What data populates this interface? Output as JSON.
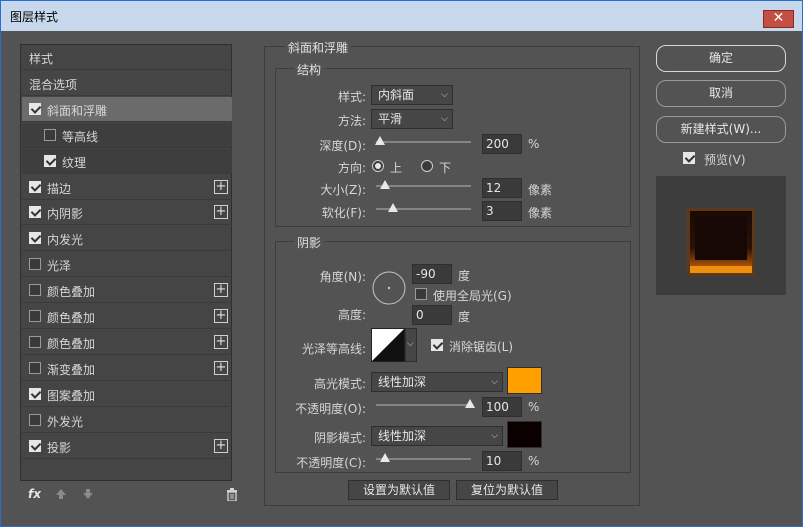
{
  "window": {
    "title": "图层样式",
    "close_glyph": "✕"
  },
  "left_panel": {
    "items": [
      {
        "label": "样式",
        "checkbox": null,
        "plus": false
      },
      {
        "label": "混合选项",
        "checkbox": null,
        "plus": false
      },
      {
        "label": "斜面和浮雕",
        "checkbox": true,
        "plus": false,
        "selected": true
      },
      {
        "label": "等高线",
        "checkbox": false,
        "plus": false,
        "sub": true
      },
      {
        "label": "纹理",
        "checkbox": true,
        "plus": false,
        "sub": true
      },
      {
        "label": "描边",
        "checkbox": true,
        "plus": true
      },
      {
        "label": "内阴影",
        "checkbox": true,
        "plus": true
      },
      {
        "label": "内发光",
        "checkbox": true,
        "plus": false
      },
      {
        "label": "光泽",
        "checkbox": false,
        "plus": false
      },
      {
        "label": "颜色叠加",
        "checkbox": false,
        "plus": true
      },
      {
        "label": "颜色叠加",
        "checkbox": false,
        "plus": true
      },
      {
        "label": "颜色叠加",
        "checkbox": false,
        "plus": true
      },
      {
        "label": "渐变叠加",
        "checkbox": false,
        "plus": true
      },
      {
        "label": "图案叠加",
        "checkbox": true,
        "plus": false
      },
      {
        "label": "外发光",
        "checkbox": false,
        "plus": false
      },
      {
        "label": "投影",
        "checkbox": true,
        "plus": true
      }
    ],
    "footer": {
      "fx": "fx",
      "up_icon": "arrow-up-icon",
      "down_icon": "arrow-down-icon",
      "trash_icon": "trash-icon"
    }
  },
  "bevel": {
    "title": "斜面和浮雕",
    "structure": {
      "title": "结构",
      "style_label": "样式:",
      "style_value": "内斜面",
      "method_label": "方法:",
      "method_value": "平滑",
      "depth_label": "深度(D):",
      "depth_value": "200",
      "depth_unit": "%",
      "direction_label": "方向:",
      "dir_up": "上",
      "dir_down": "下",
      "size_label": "大小(Z):",
      "size_value": "12",
      "size_unit": "像素",
      "soften_label": "软化(F):",
      "soften_value": "3",
      "soften_unit": "像素"
    },
    "shading": {
      "title": "阴影",
      "angle_label": "角度(N):",
      "angle_value": "-90",
      "angle_unit": "度",
      "global_light": "使用全局光(G)",
      "altitude_label": "高度:",
      "altitude_value": "0",
      "altitude_unit": "度",
      "gloss_label": "光泽等高线:",
      "antialias": "消除锯齿(L)",
      "highlight_label": "高光模式:",
      "highlight_mode": "线性加深",
      "highlight_color": "#ffa000",
      "opacity1_label": "不透明度(O):",
      "opacity1_value": "100",
      "opacity1_unit": "%",
      "shadow_label": "阴影模式:",
      "shadow_mode": "线性加深",
      "shadow_color": "#0a0000",
      "opacity2_label": "不透明度(C):",
      "opacity2_value": "10",
      "opacity2_unit": "%"
    },
    "make_default": "设置为默认值",
    "reset_default": "复位为默认值"
  },
  "right": {
    "ok": "确定",
    "cancel": "取消",
    "new_style": "新建样式(W)...",
    "preview": "预览(V)"
  }
}
